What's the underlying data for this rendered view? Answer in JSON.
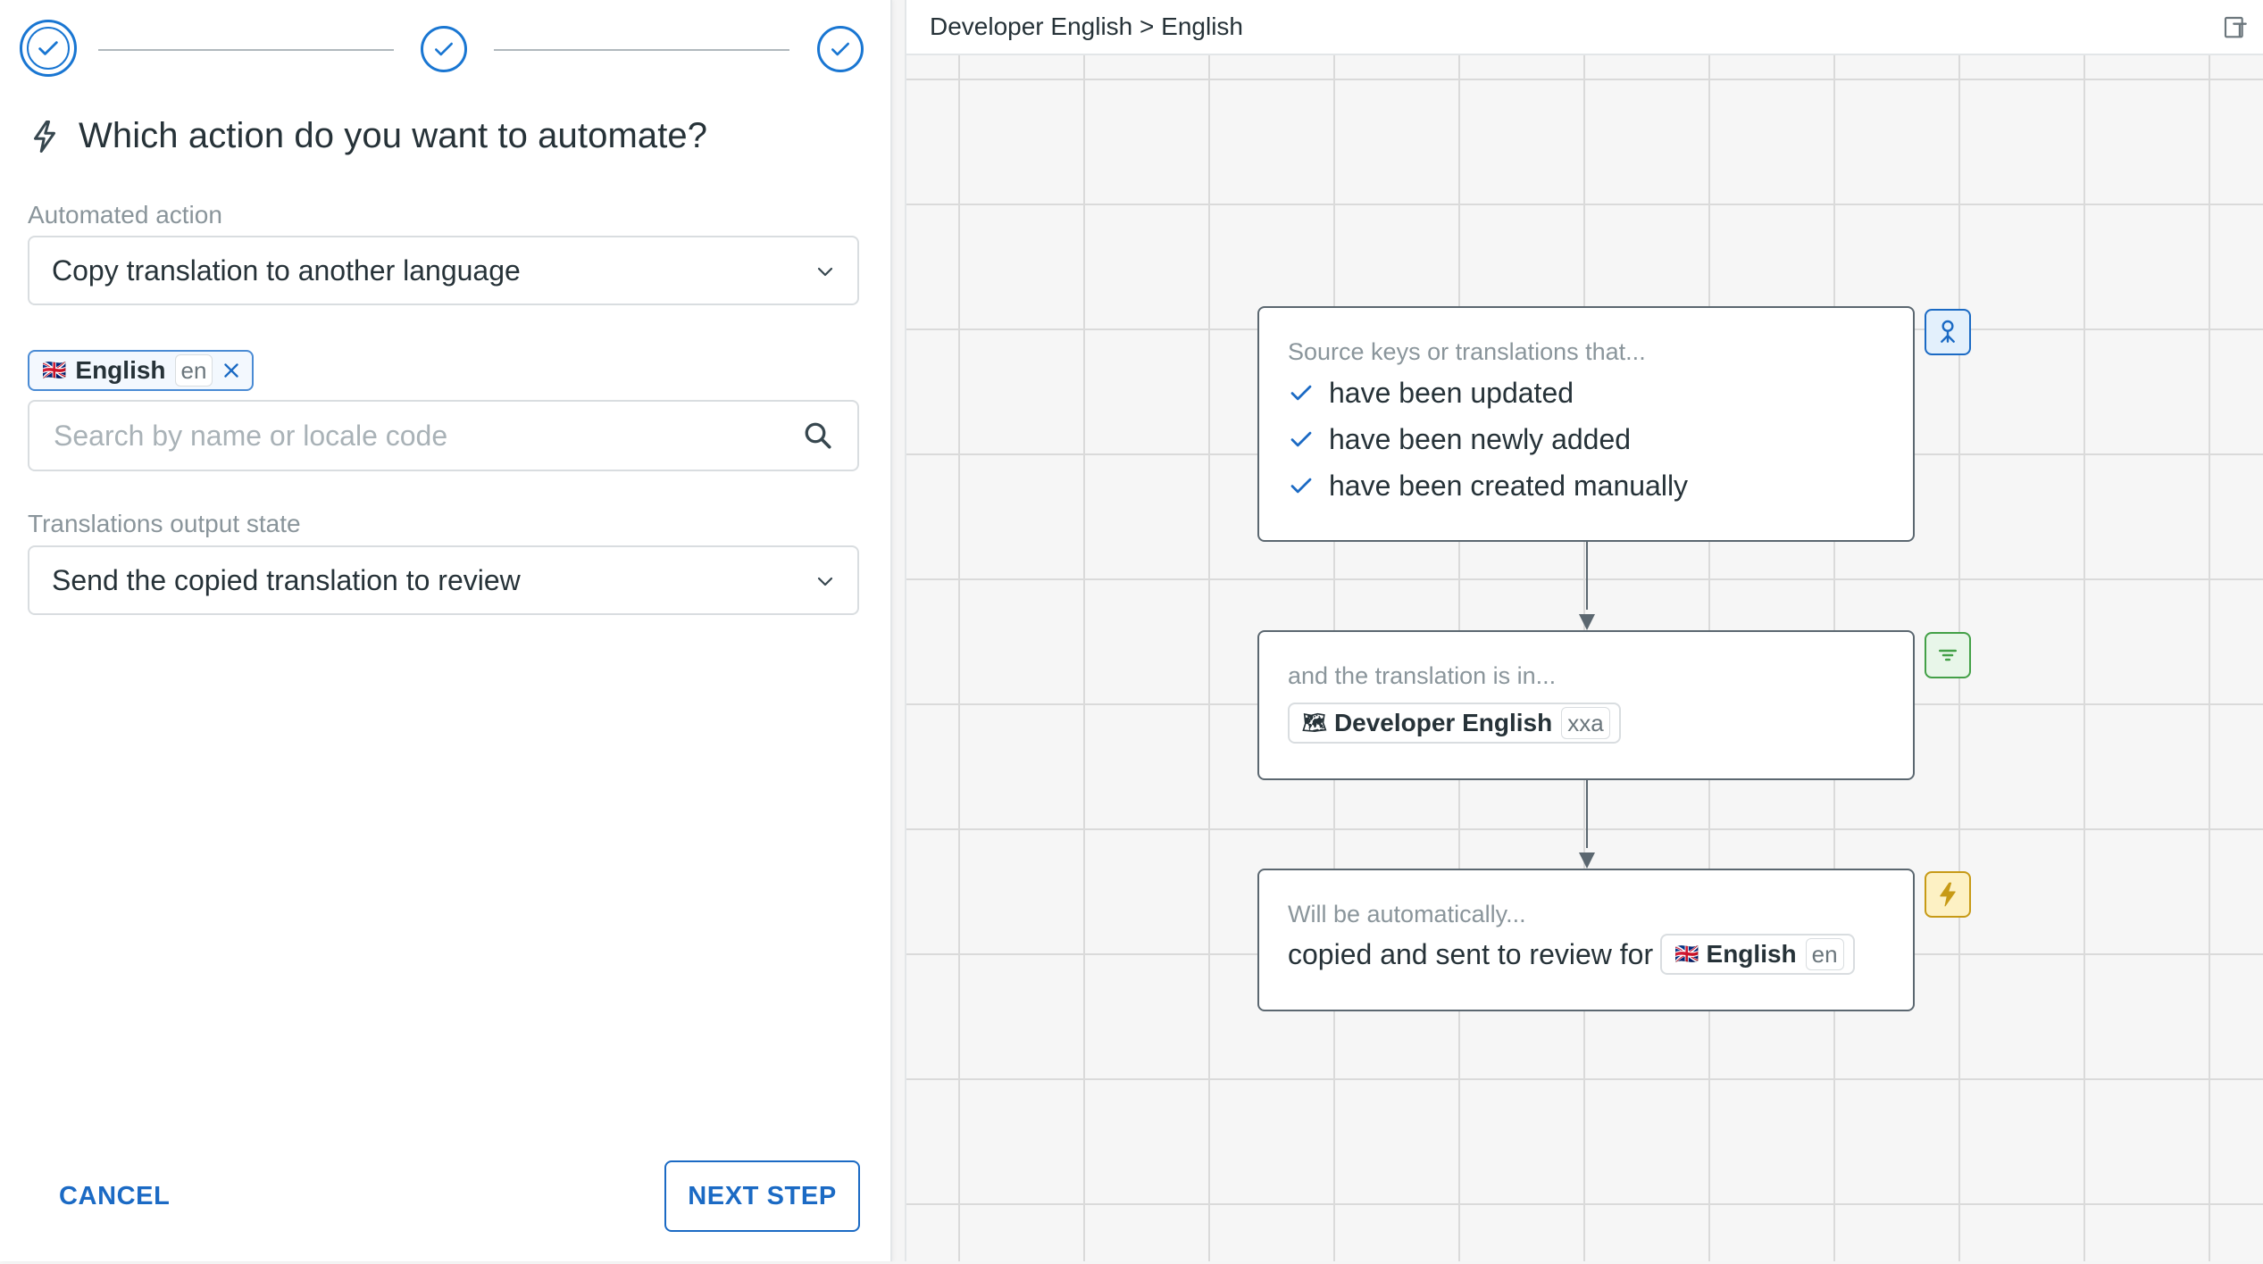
{
  "wizard": {
    "steps": [
      {
        "state": "current-complete"
      },
      {
        "state": "complete"
      },
      {
        "state": "complete"
      }
    ],
    "heading": "Which action do you want to automate?",
    "automated_action": {
      "label": "Automated action",
      "value": "Copy translation to another language"
    },
    "selected_language": {
      "flag": "🇬🇧",
      "name": "English",
      "code": "en"
    },
    "language_search": {
      "placeholder": "Search by name or locale code",
      "value": ""
    },
    "output_state": {
      "label": "Translations output state",
      "value": "Send the copied translation to review"
    },
    "buttons": {
      "cancel": "CANCEL",
      "next": "NEXT STEP"
    }
  },
  "canvas": {
    "breadcrumb": "Developer English > English",
    "trigger_node": {
      "caption": "Source keys or translations that...",
      "conditions": [
        "have been updated",
        "have been newly added",
        "have been created manually"
      ]
    },
    "filter_node": {
      "caption": "and the translation is in...",
      "locale": {
        "flag": "🗺",
        "name": "Developer English",
        "code": "xxa"
      }
    },
    "action_node": {
      "caption": "Will be automatically...",
      "text": "copied and sent to review for",
      "locale": {
        "flag": "🇬🇧",
        "name": "English",
        "code": "en"
      }
    }
  },
  "icons": {
    "step": "check-circle-icon",
    "heading": "lightning-bolt-icon",
    "dropdown": "chevron-down-icon",
    "remove": "close-icon",
    "search": "search-icon",
    "header_corner": "panel-toggle-icon",
    "trigger_badge": "person-tree-icon",
    "filter_badge": "filter-icon",
    "action_badge": "lightning-bolt-icon"
  },
  "colors": {
    "primary": "#1b6ac4",
    "step_blue": "#1976d2",
    "filter_green": "#43a047",
    "action_yellow": "#c79a16",
    "text": "#263238",
    "muted": "#8a959b"
  }
}
